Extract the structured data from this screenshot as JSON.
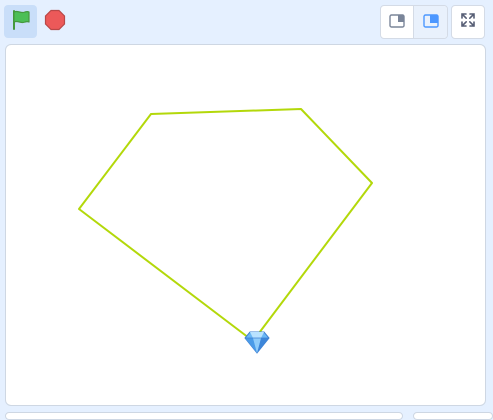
{
  "toolbar": {
    "green_flag": {
      "icon": "green-flag-icon",
      "color": "#4cbf56",
      "active": true
    },
    "stop": {
      "icon": "stop-sign-icon",
      "color": "#ec5959"
    },
    "layout_small": {
      "icon": "small-stage-icon"
    },
    "layout_normal": {
      "icon": "normal-stage-icon",
      "selected": true
    },
    "fullscreen": {
      "icon": "fullscreen-icon"
    }
  },
  "stage": {
    "pen_color": "#b3d80a",
    "sprite": {
      "name": "diamond-sprite",
      "icon": "diamond-icon",
      "color": "#4c97ff"
    }
  }
}
